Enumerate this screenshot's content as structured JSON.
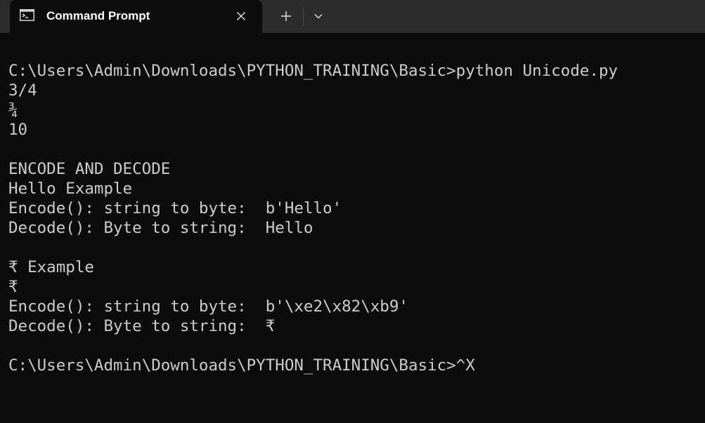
{
  "window": {
    "tab_title": "Command Prompt",
    "tab_icon": "command-prompt-icon",
    "close_icon": "close-icon",
    "new_tab_icon": "plus-icon",
    "dropdown_icon": "chevron-down-icon"
  },
  "colors": {
    "background": "#0c0c0c",
    "titlebar": "#2b2b2b",
    "text": "#cccccc"
  },
  "terminal": {
    "lines": [
      "",
      "C:\\Users\\Admin\\Downloads\\PYTHON_TRAINING\\Basic>python Unicode.py",
      "3/4",
      "¾",
      "10",
      "",
      "ENCODE AND DECODE",
      "Hello Example",
      "Encode(): string to byte:  b'Hello'",
      "Decode(): Byte to string:  Hello",
      "",
      "₹ Example",
      "₹",
      "Encode(): string to byte:  b'\\xe2\\x82\\xb9'",
      "Decode(): Byte to string:  ₹",
      "",
      "C:\\Users\\Admin\\Downloads\\PYTHON_TRAINING\\Basic>^X"
    ]
  }
}
